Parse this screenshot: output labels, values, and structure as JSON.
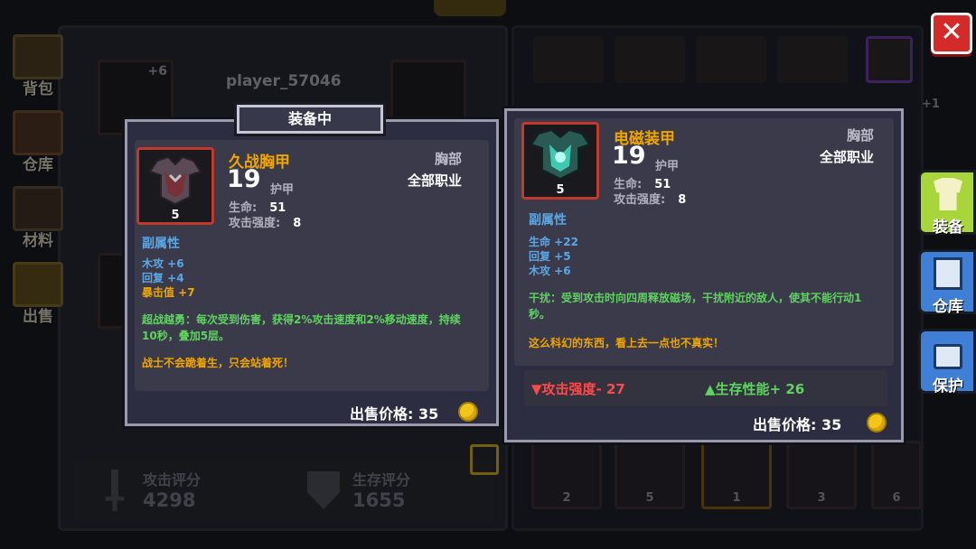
{
  "left_tabs": [
    {
      "label": "背包",
      "icon": "chest-icon"
    },
    {
      "label": "仓库",
      "icon": "storage-icon"
    },
    {
      "label": "材料",
      "icon": "materials-icon"
    },
    {
      "label": "出售",
      "icon": "sell-icon"
    }
  ],
  "right_tabs": [
    {
      "label": "装备",
      "icon": "armor-icon",
      "color": "#a8d63a"
    },
    {
      "label": "仓库",
      "icon": "storage-box-icon",
      "color": "#3f7fd6"
    },
    {
      "label": "保护",
      "icon": "lock-icon",
      "color": "#3f7fd6"
    }
  ],
  "player": {
    "name": "player_57046",
    "slot_bonus": "+6"
  },
  "scores": {
    "attack_label": "攻击评分",
    "attack_value": "4298",
    "survival_label": "生存评分",
    "survival_value": "1655"
  },
  "inventory_counts": [
    "2",
    "5",
    "1",
    "3",
    "6"
  ],
  "right_grid_count": "+1",
  "equipped_banner": "装备中",
  "equipped_item": {
    "name": "久战胸甲",
    "slot": "胸部",
    "class": "全部职业",
    "armor_value": "19",
    "armor_label": "护甲",
    "level": "5",
    "stats": [
      {
        "label": "生命:",
        "value": "51"
      },
      {
        "label": "攻击强度:",
        "value": "8"
      }
    ],
    "sub_title": "副属性",
    "sub_stats": [
      {
        "text": "木攻 +6",
        "color": "#5aa8e8"
      },
      {
        "text": "回复 +4",
        "color": "#5aa8e8"
      },
      {
        "text": "暴击值 +7",
        "color": "#f0a500"
      }
    ],
    "effect": "超战越勇：每次受到伤害，获得2%攻击速度和2%移动速度，持续10秒，叠加5层。",
    "flavor": "战士不会跪着生，只会站着死！",
    "price_label": "出售价格: 35"
  },
  "new_item": {
    "name": "电磁装甲",
    "slot": "胸部",
    "class": "全部职业",
    "armor_value": "19",
    "armor_label": "护甲",
    "level": "5",
    "stats": [
      {
        "label": "生命:",
        "value": "51"
      },
      {
        "label": "攻击强度:",
        "value": "8"
      }
    ],
    "sub_title": "副属性",
    "sub_stats": [
      {
        "text": "生命 +22",
        "color": "#5aa8e8"
      },
      {
        "text": "回复 +5",
        "color": "#5aa8e8"
      },
      {
        "text": "木攻 +6",
        "color": "#5aa8e8"
      }
    ],
    "effect": "干扰：受到攻击时向四周释放磁场，干扰附近的敌人，使其不能行动1秒。",
    "flavor": "这么科幻的东西，看上去一点也不真实！",
    "price_label": "出售价格: 35"
  },
  "comparison": {
    "attack_change": "▼攻击强度- 27",
    "survival_change": "▲生存性能+ 26"
  },
  "colors": {
    "item_name": "#f0a500",
    "effect_text": "#5fd35f",
    "flavor_text": "#f0a500",
    "decrease": "#ff4a4a",
    "increase": "#5fd35f",
    "close_button": "#d52a2a"
  }
}
